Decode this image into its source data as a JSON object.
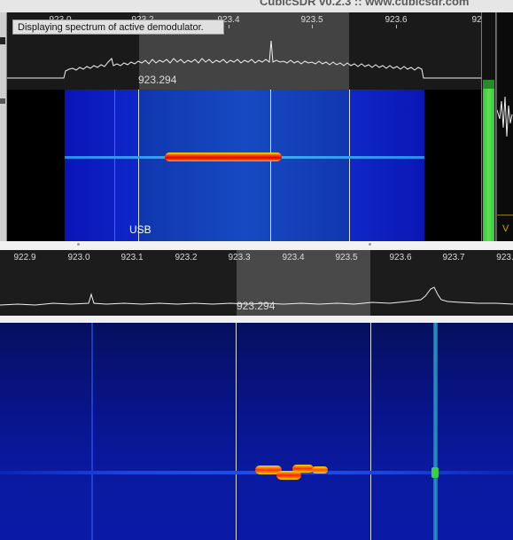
{
  "window": {
    "title": "CubicSDR v0.2.3 :: www.cubicsdr.com"
  },
  "tooltip": {
    "text": "Displaying spectrum of active demodulator."
  },
  "demod_spectrum": {
    "ticks": [
      "923.0",
      "923.2",
      "923.4",
      "923.5",
      "923.6",
      "92"
    ],
    "center_freq_label": "923.294"
  },
  "demod_waterfall": {
    "mode_label": "USB"
  },
  "meter": {
    "label": "V",
    "level_fraction": 0.67
  },
  "main_spectrum": {
    "ticks": [
      "922.9",
      "923.0",
      "923.1",
      "923.2",
      "923.3",
      "923.4",
      "923.5",
      "923.6",
      "923.7",
      "923."
    ],
    "center_freq_label": "923.294"
  },
  "colors": {
    "waterfall_blue": "#1540e0",
    "signal_red": "#e00000",
    "signal_yellow": "#f7e600",
    "meter_green": "#39c83a"
  }
}
